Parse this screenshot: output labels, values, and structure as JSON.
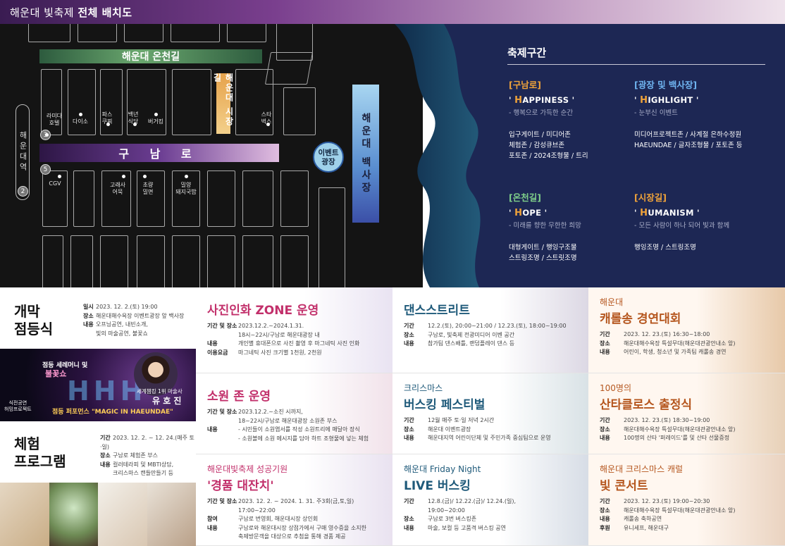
{
  "header": {
    "title_prefix": "해운대 빛축제 ",
    "title_bold": "전체 배치도"
  },
  "map": {
    "roads": {
      "onchen": "해운대 온천길",
      "gunam": "구 남 로",
      "sijang": "해운대 시장길",
      "baekhwajeom": "해운대 백사장"
    },
    "station": "해운대역",
    "exits": [
      "3",
      "5",
      "2"
    ],
    "event_plaza": [
      "이벤트",
      "광장"
    ],
    "pois": {
      "lamida": [
        "라미다",
        "호텔"
      ],
      "daiso": "다이소",
      "pasikuri": [
        "파스",
        "쿠찌"
      ],
      "baeknyeon": [
        "백년",
        "식당"
      ],
      "burger": "버거킹",
      "starbucks": [
        "스타",
        "벅스"
      ],
      "cgv": "CGV",
      "gorae": [
        "고래사",
        "어묵"
      ],
      "chorang": [
        "초량",
        "밀면"
      ],
      "mirang": [
        "밀양",
        "돼지국밥"
      ]
    }
  },
  "festival": {
    "title": "축제구간",
    "zones": [
      {
        "name": "[구남로]",
        "name_color": "#f0a33a",
        "cap": "H",
        "word": "APPINESS",
        "sub": "- 행복으로 가득한 순간",
        "items": [
          "입구게이트 / 미디어존",
          "체험존 / 감성큐브존",
          "포토존 / 2024조형물 / 트리"
        ]
      },
      {
        "name": "[광장 및 백사장]",
        "name_color": "#6fb4f0",
        "cap": "H",
        "word": "IGHLIGHT",
        "sub": "- 눈부신 이벤트",
        "items": [
          "미디어프로젝트존 / 사계절 은하수정원",
          "HAEUNDAE / 글자조형물 / 포토존 등"
        ]
      },
      {
        "name": "[온천길]",
        "name_color": "#7fcf8a",
        "cap": "H",
        "word": "OPE",
        "sub": "- 미래를 향한 무한한 희망",
        "items": [
          "대형게이트 / 행잉구조물",
          "스트링조명 / 스트릿조명"
        ]
      },
      {
        "name": "[시장길]",
        "name_color": "#f0a33a",
        "cap": "H",
        "word": "UMANISM",
        "sub": "- 모든 사람이 하나 되어 빛과 함께",
        "items": [
          "행잉조명 / 스트링조명"
        ]
      }
    ]
  },
  "left": {
    "opening": {
      "title": [
        "개막",
        "점등식"
      ],
      "rows": [
        {
          "k": "일시",
          "v": "2023. 12. 2.(토) 19:00"
        },
        {
          "k": "장소",
          "v": "해운대해수욕장 이벤트광장 앞 백사장"
        },
        {
          "k": "내용",
          "v": "오프닝공연, 내빈소개,"
        },
        {
          "k": "",
          "v": "빛의 마술공연, 불꽃쇼"
        }
      ]
    },
    "photo": {
      "t1": "점등 세레머니 및",
      "t2": "불꽃쇼",
      "t3": "세계챔킹 1위 마술사",
      "t4": "유 호 진",
      "t5": "점등 퍼포먼스 \"MAGIC IN HAEUNDAE\"",
      "t6": [
        "식전공연",
        "허밍프로젝트"
      ]
    },
    "experience": {
      "title": [
        "체험",
        "프로그램"
      ],
      "rows": [
        {
          "k": "기간",
          "v": "2023. 12. 2. ~ 12. 24.(매주 토·일)"
        },
        {
          "k": "장소",
          "v": "구남로 체험존 부스"
        },
        {
          "k": "내용",
          "v": "컬러테라피 및 MBTI상담,"
        },
        {
          "k": "",
          "v": "크리스마스 캔들만들기 등"
        }
      ]
    }
  },
  "cards": [
    {
      "id": "photo-zone",
      "pre": "",
      "title": "사진인화 ZONE 운영",
      "title_color": "#c2306b",
      "rows": [
        {
          "k": "기간 및 장소",
          "v": "2023.12.2.~2024.1.31."
        },
        {
          "k": "",
          "v": "18시~22시/구남로 해운대광장 내"
        },
        {
          "k": "내용",
          "v": "개인별 휴대폰으로 사진 촬영 후 마그네틱 사진 인화"
        },
        {
          "k": "이용요금",
          "v": "마그네틱 사진 크기별 1천원, 2천원"
        }
      ]
    },
    {
      "id": "dance",
      "pre": "",
      "title": "댄스스트리트",
      "title_color": "#1f5a7a",
      "rows": [
        {
          "k": "기간",
          "v": "12.2.(토), 20:00~21:00 / 12.23.(토), 18:00~19:00"
        },
        {
          "k": "장소",
          "v": "구남로, 빛축제 전광미디어 이벤 공간"
        },
        {
          "k": "내용",
          "v": "참가팀 댄스배틀, 랜덤플레이 댄스 등"
        }
      ]
    },
    {
      "id": "carol",
      "pre": "해운대",
      "title": "캐롤송 경연대회",
      "title_color": "#b5561e",
      "rows": [
        {
          "k": "기간",
          "v": "2023. 12. 23.(토) 16:30~18:00"
        },
        {
          "k": "장소",
          "v": "해운대해수욕장 특설무대(해운대관광안내소 앞)"
        },
        {
          "k": "내용",
          "v": "어린이, 학생, 청소년 및 가족팀 캐롤송 경연"
        }
      ]
    },
    {
      "id": "wish",
      "pre": "",
      "title": "소원 존 운영",
      "title_color": "#c2306b",
      "rows": [
        {
          "k": "기간 및 장소",
          "v": "2023.12.2.~소진 시까지,"
        },
        {
          "k": "",
          "v": "18~22시/구남로 해운대광장 소원존 부스"
        },
        {
          "k": "내용",
          "v": "- 시민들이 소원엽서를 작성 소원트리에 매달아 장식"
        },
        {
          "k": "",
          "v": "- 소원볼에 소원 메시지를 담아 하트 조형물에 넣는 체험"
        }
      ]
    },
    {
      "id": "busking-fest",
      "pre": "크리스마스",
      "title": "버스킹 페스티벌",
      "title_color": "#1f5a7a",
      "rows": [
        {
          "k": "기간",
          "v": "12월 매주 토·일 저녁 2시간"
        },
        {
          "k": "장소",
          "v": "해운대 이벤트광장"
        },
        {
          "k": "내용",
          "v": "해운대지역 어린이단체 및 주민가족 중심팀으로 운영"
        }
      ]
    },
    {
      "id": "santa",
      "pre": "100명의",
      "title": "산타클로스 출정식",
      "title_color": "#b5561e",
      "rows": [
        {
          "k": "기간",
          "v": "2023. 12. 23.(토) 18:30~19:00"
        },
        {
          "k": "장소",
          "v": "해운대해수욕장 특설무대(해운대관광안내소 앞)"
        },
        {
          "k": "내용",
          "v": "100명의 산타 '퍼레이드'를 및 산타 선물증정"
        }
      ]
    },
    {
      "id": "lottery",
      "pre": "해운대빛축제 성공기원",
      "title": "'경품 대잔치'",
      "title_color": "#c2306b",
      "rows": [
        {
          "k": "기간 및 장소",
          "v": "2023. 12. 2. ~ 2024. 1. 31. 주3회(금,토,일) 17:00~22:00"
        },
        {
          "k": "참여",
          "v": "구남로 번영회, 해운대시장 상인회"
        },
        {
          "k": "내용",
          "v": "구남로와 해운대시장 상점가에서 구매 영수증을 소지한"
        },
        {
          "k": "",
          "v": "축제방문객을 대상으로 추첨을 통해 경품 제공"
        }
      ]
    },
    {
      "id": "friday",
      "pre": "해운대 Friday Night",
      "title": "LIVE 버스킹",
      "title_color": "#1f5a7a",
      "rows": [
        {
          "k": "기간",
          "v": "12.8.(금)/ 12.22.(금)/ 12.24.(일),"
        },
        {
          "k": "",
          "v": "19:00~20:00"
        },
        {
          "k": "장소",
          "v": "구남로 3번 버스킹존"
        },
        {
          "k": "내용",
          "v": "마술, 보컬 등 고품격 버스킹 공연"
        }
      ]
    },
    {
      "id": "concert",
      "pre": "해운대 크리스마스 캐럴",
      "title": "빛 콘서트",
      "title_color": "#b5561e",
      "rows": [
        {
          "k": "기간",
          "v": "2023. 12. 23.(토) 19:00~20:30"
        },
        {
          "k": "장소",
          "v": "해운대해수욕장 특설무대(해운대관광안내소 앞)"
        },
        {
          "k": "내용",
          "v": "캐롤송 축하공연"
        },
        {
          "k": "후원",
          "v": "유니세프, 해운대구"
        }
      ]
    }
  ]
}
